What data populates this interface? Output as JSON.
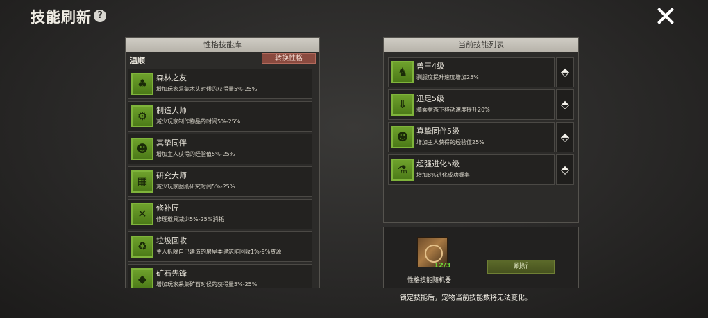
{
  "header": {
    "title": "技能刷新",
    "help_icon": "?"
  },
  "library": {
    "title": "性格技能库",
    "current_trait": "温顺",
    "switch_label": "转换性格",
    "skills": [
      {
        "name": "森林之友",
        "desc": "增加玩家采集木头时候的获得量5%-25%",
        "icon": "tree-icon",
        "glyph": "♣"
      },
      {
        "name": "制造大师",
        "desc": "减少玩家制作物品的时间5%-25%",
        "icon": "gears-icon",
        "glyph": "⚙"
      },
      {
        "name": "真挚同伴",
        "desc": "增加主人获得的经验值5%-25%",
        "icon": "pet-face-icon",
        "glyph": "☻"
      },
      {
        "name": "研究大师",
        "desc": "减少玩家图纸研究时间5%-25%",
        "icon": "blueprint-icon",
        "glyph": "▦"
      },
      {
        "name": "修补匠",
        "desc": "修理道具减少5%-25%消耗",
        "icon": "tools-icon",
        "glyph": "✕"
      },
      {
        "name": "垃圾回收",
        "desc": "主人拆除自己建造的房屋类建筑能回收1%-9%资源",
        "icon": "recycle-icon",
        "glyph": "♻"
      },
      {
        "name": "矿石先锋",
        "desc": "增加玩家采集矿石时候的获得量5%-25%",
        "icon": "ore-icon",
        "glyph": "◆"
      }
    ]
  },
  "current": {
    "title": "当前技能列表",
    "skills": [
      {
        "name": "兽王4级",
        "desc": "驯服度提升速度增加25%",
        "icon": "beast-king-icon",
        "glyph": "♞"
      },
      {
        "name": "迅足5级",
        "desc": "骑乘状态下移动速度提升20%",
        "icon": "swift-foot-icon",
        "glyph": "⇓"
      },
      {
        "name": "真挚同伴5级",
        "desc": "增加主人获得的经验值25%",
        "icon": "pet-face-icon",
        "glyph": "☻"
      },
      {
        "name": "超强进化5级",
        "desc": "增加8%进化成功概率",
        "icon": "flask-icon",
        "glyph": "⚗"
      }
    ],
    "lock_glyph": "⬘"
  },
  "generator": {
    "count": "12/3",
    "label": "性格技能随机器",
    "refresh_label": "刷新"
  },
  "warning": "锁定技能后，宠物当前技能数将无法变化。"
}
